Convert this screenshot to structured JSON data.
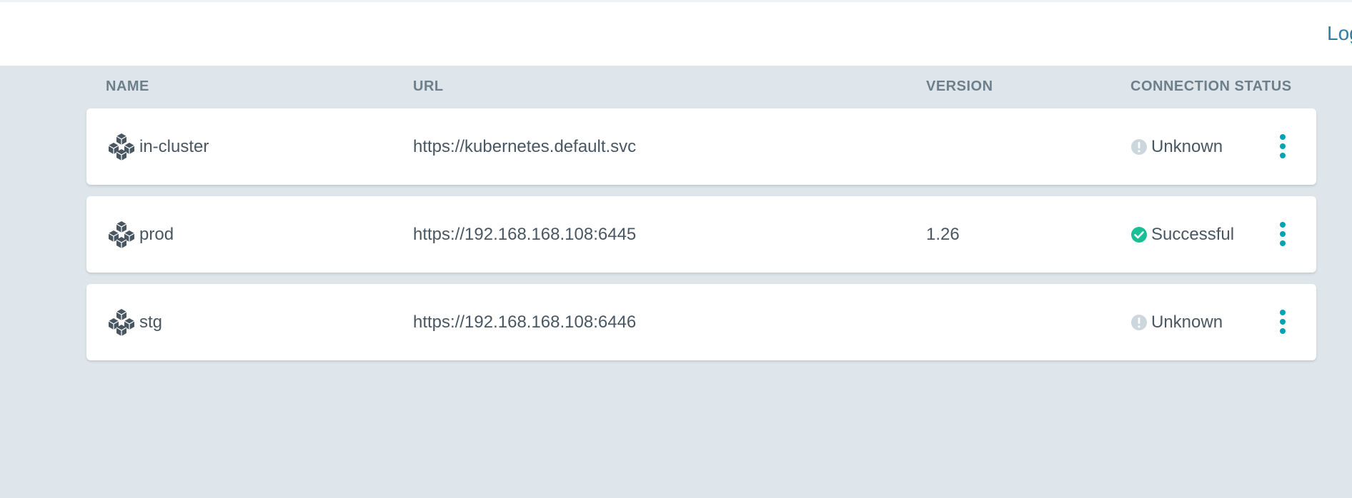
{
  "header": {
    "logout_label": "Log"
  },
  "table": {
    "columns": {
      "name": "NAME",
      "url": "URL",
      "version": "VERSION",
      "status": "CONNECTION STATUS"
    },
    "rows": [
      {
        "name": "in-cluster",
        "url": "https://kubernetes.default.svc",
        "version": "",
        "status": "Unknown",
        "status_icon": "unknown-status-icon"
      },
      {
        "name": "prod",
        "url": "https://192.168.168.108:6445",
        "version": "1.26",
        "status": "Successful",
        "status_icon": "success-status-icon"
      },
      {
        "name": "stg",
        "url": "https://192.168.168.108:6446",
        "version": "",
        "status": "Unknown",
        "status_icon": "unknown-status-icon"
      }
    ]
  },
  "colors": {
    "background": "#dee6eb",
    "header_text": "#6d7f8b",
    "body_text": "#495763",
    "accent": "#00a2b3",
    "success": "#18be94",
    "unknown": "#ccd6dd",
    "link": "#2e7fa6"
  }
}
